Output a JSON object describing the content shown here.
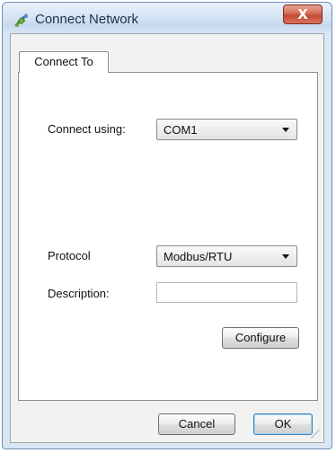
{
  "window": {
    "title": "Connect Network",
    "close_glyph": "X",
    "icon": "network-plug-icon"
  },
  "tabs": [
    {
      "label": "Connect To",
      "active": true
    }
  ],
  "form": {
    "connect_using": {
      "label": "Connect using:",
      "selected": "COM1"
    },
    "protocol": {
      "label": "Protocol",
      "selected": "Modbus/RTU"
    },
    "description": {
      "label": "Description:",
      "value": "",
      "placeholder": ""
    },
    "configure_label": "Configure"
  },
  "buttons": {
    "cancel_label": "Cancel",
    "ok_label": "OK"
  },
  "colors": {
    "title_bar": "#c8daef",
    "close_button": "#c24b36",
    "panel_background": "#ffffff",
    "dialog_background": "#f2f2f2"
  }
}
